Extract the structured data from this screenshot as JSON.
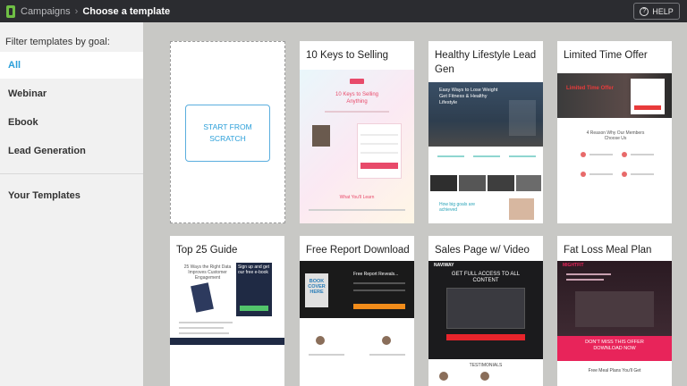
{
  "topbar": {
    "breadcrumb_root": "Campaigns",
    "breadcrumb_sep": "›",
    "breadcrumb_current": "Choose a template",
    "help_label": "HELP",
    "help_icon": "?"
  },
  "sidebar": {
    "filter_title": "Filter templates by goal:",
    "items": [
      {
        "label": "All",
        "active": true
      },
      {
        "label": "Webinar"
      },
      {
        "label": "Ebook"
      },
      {
        "label": "Lead Generation"
      }
    ],
    "your_templates": "Your Templates"
  },
  "scratch": {
    "label": "START FROM SCRATCH"
  },
  "templates": [
    {
      "title": "10 Keys to Selling",
      "thumb_heading": "10 Keys to Selling Anything",
      "thumb_footer": "What You'll Learn"
    },
    {
      "title": "Healthy Lifestyle Lead Gen",
      "thumb_heading": "Easy Ways to Lose Weight Get Fitness & Healthy Lifestyle",
      "thumb_footer": "How big goals are achieved"
    },
    {
      "title": "Limited Time Offer",
      "thumb_heading": "Limited Time Offer",
      "thumb_sub": "4 Reason Why Our Members Choose Us"
    },
    {
      "title": "Top 25 Guide",
      "thumb_heading": "25 Ways the Right Data Improves Customer Engagement",
      "thumb_cta": "Sign up and get our free e-book"
    },
    {
      "title": "Free Report Download",
      "thumb_book": "BOOK COVER HERE",
      "thumb_heading": "Free Report Reveals..."
    },
    {
      "title": "Sales Page w/ Video",
      "thumb_brand": "NAVIWAY",
      "thumb_heading": "GET FULL ACCESS TO ALL CONTENT",
      "thumb_sub": "TESTIMONIALS"
    },
    {
      "title": "Fat Loss Meal Plan",
      "thumb_brand": "MIGHTFIT",
      "thumb_cta": "DON'T MISS THIS OFFER DOWNLOAD NOW",
      "thumb_sub": "Free Meal Plans You'll Get"
    }
  ],
  "colors": {
    "topbar_bg": "#2b2c30",
    "accent": "#2b9fd9",
    "logo_green": "#6fbf45",
    "canvas_bg": "#c8c8c5"
  }
}
